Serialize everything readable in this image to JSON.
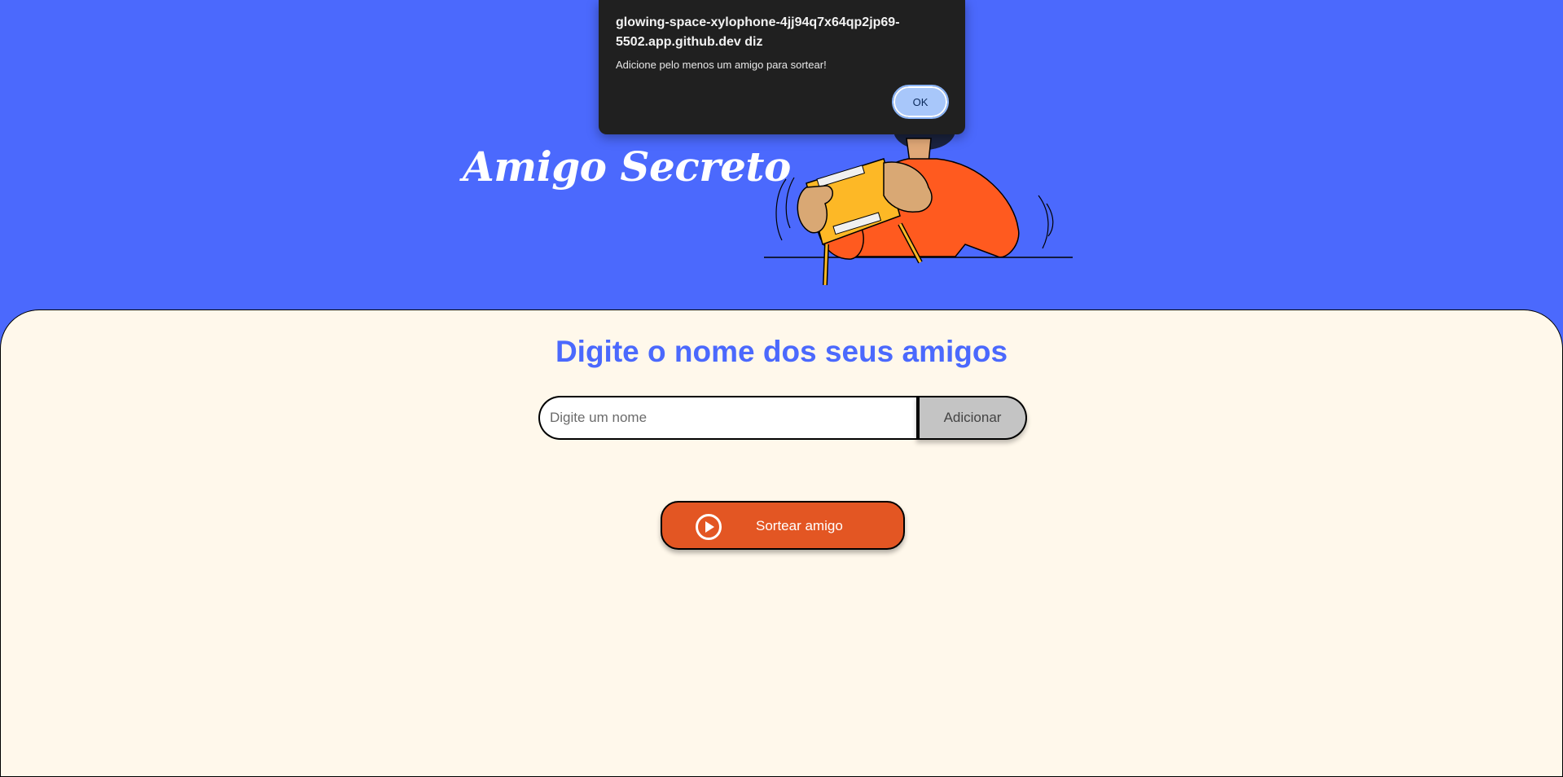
{
  "header": {
    "title": "Amigo Secreto"
  },
  "main": {
    "section_title": "Digite o nome dos seus amigos",
    "name_input": {
      "placeholder": "Digite um nome",
      "value": ""
    },
    "add_button_label": "Adicionar",
    "draw_button_label": "Sortear amigo",
    "draw_button_icon": "play-circle-icon"
  },
  "dialog": {
    "origin": "glowing-space-xylophone-4jj94q7x64qp2jp69-5502.app.github.dev diz",
    "message": "Adicione pelo menos um amigo para sortear!",
    "ok_label": "OK"
  },
  "colors": {
    "header_bg": "#4B69FD",
    "main_bg": "#FFF8EB",
    "accent_title": "#4B69FD",
    "draw_button": "#E35623",
    "add_button": "#C4C4C4",
    "dialog_bg": "#202020",
    "ok_button": "#A8C7FA"
  }
}
